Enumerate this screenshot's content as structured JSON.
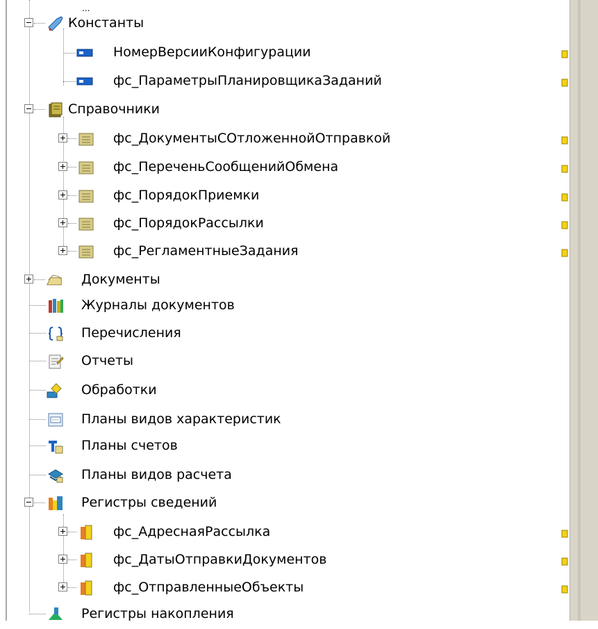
{
  "tree": {
    "top_partial_text": "...",
    "constants": {
      "label": "Константы",
      "children": [
        "НомерВерсииКонфигурации",
        "фс_ПараметрыПланировщикаЗаданий"
      ]
    },
    "catalogs": {
      "label": "Справочники",
      "children": [
        "фс_ДокументыСОтложеннойОтправкой",
        "фс_ПереченьСообщенийОбмена",
        "фс_ПорядокПриемки",
        "фс_ПорядокРассылки",
        "фс_РегламентныеЗадания"
      ]
    },
    "documents": "Документы",
    "journals": "Журналы документов",
    "enums": "Перечисления",
    "reports": "Отчеты",
    "processors": "Обработки",
    "char_types": "Планы видов характеристик",
    "accounts": "Планы счетов",
    "calc_types": "Планы видов расчета",
    "info_registers": {
      "label": "Регистры сведений",
      "children": [
        "фс_АдреснаяРассылка",
        "фс_ДатыОтправкиДокументов",
        "фс_ОтправленныеОбъекты"
      ]
    },
    "accum_registers": "Регистры накопления"
  }
}
